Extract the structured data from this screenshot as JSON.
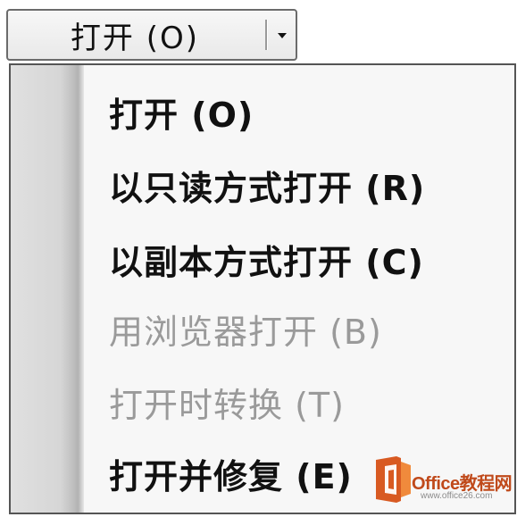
{
  "split_button": {
    "label": "打开 (O)"
  },
  "menu": {
    "items": [
      {
        "label": "打开 (O)",
        "enabled": true
      },
      {
        "label": "以只读方式打开 (R)",
        "enabled": true
      },
      {
        "label": "以副本方式打开 (C)",
        "enabled": true
      },
      {
        "label": "用浏览器打开 (B)",
        "enabled": false
      },
      {
        "label": "打开时转换 (T)",
        "enabled": false
      },
      {
        "label": "打开并修复 (E)",
        "enabled": true
      }
    ]
  },
  "watermark": {
    "brand": "Office教程网",
    "url": "www.office26.com"
  },
  "colors": {
    "enabled_text": "#111111",
    "disabled_text": "#9a9a9a",
    "menu_background": "#f7f7f7",
    "gutter": "#d6d6d6",
    "watermark_brand": "#c04a1b"
  }
}
